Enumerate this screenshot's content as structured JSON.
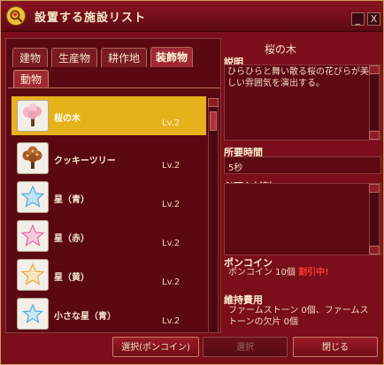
{
  "window": {
    "title": "設置する施設リスト",
    "minimize_label": "_",
    "close_label": "X"
  },
  "tabs": [
    {
      "label": "建物",
      "active": false
    },
    {
      "label": "生産物",
      "active": false
    },
    {
      "label": "耕作地",
      "active": false
    },
    {
      "label": "装飾物",
      "active": true
    }
  ],
  "subtab": {
    "label": "動物"
  },
  "items": [
    {
      "name": "桜の木",
      "level": "Lv.2",
      "icon": "cherry-tree-icon",
      "selected": true
    },
    {
      "name": "クッキーツリー",
      "level": "Lv.2",
      "icon": "cookie-tree-icon",
      "selected": false
    },
    {
      "name": "星（青）",
      "level": "Lv.2",
      "icon": "blue-star-icon",
      "selected": false
    },
    {
      "name": "星（赤）",
      "level": "Lv.2",
      "icon": "pink-star-icon",
      "selected": false
    },
    {
      "name": "星（黄）",
      "level": "Lv.2",
      "icon": "yellow-star-icon",
      "selected": false
    },
    {
      "name": "小さな星（青）",
      "level": "Lv.2",
      "icon": "small-blue-star-icon",
      "selected": false
    }
  ],
  "detail": {
    "name": "桜の木",
    "description_label": "説明",
    "description": "ひらひらと舞い散る桜の花びらが美しい雰囲気を演出する。",
    "time_label": "所要時間",
    "time_value": "5秒",
    "materials_label": "必要な材料",
    "coin_label": "ポンコイン",
    "coin_value": "ポンコイン 10個",
    "coin_badge": "割引中!",
    "upkeep_label": "維持費用",
    "upkeep_value": "ファームストーン 0個、ファームストーンの欠片 0個"
  },
  "buttons": {
    "select_coin": "選択(ポンコイン)",
    "select": "選択",
    "close": "閉じる"
  },
  "colors": {
    "selected_row": "#e6b21c",
    "window_bg": "#7a0e1a",
    "sale_text": "#ff3a2a"
  }
}
